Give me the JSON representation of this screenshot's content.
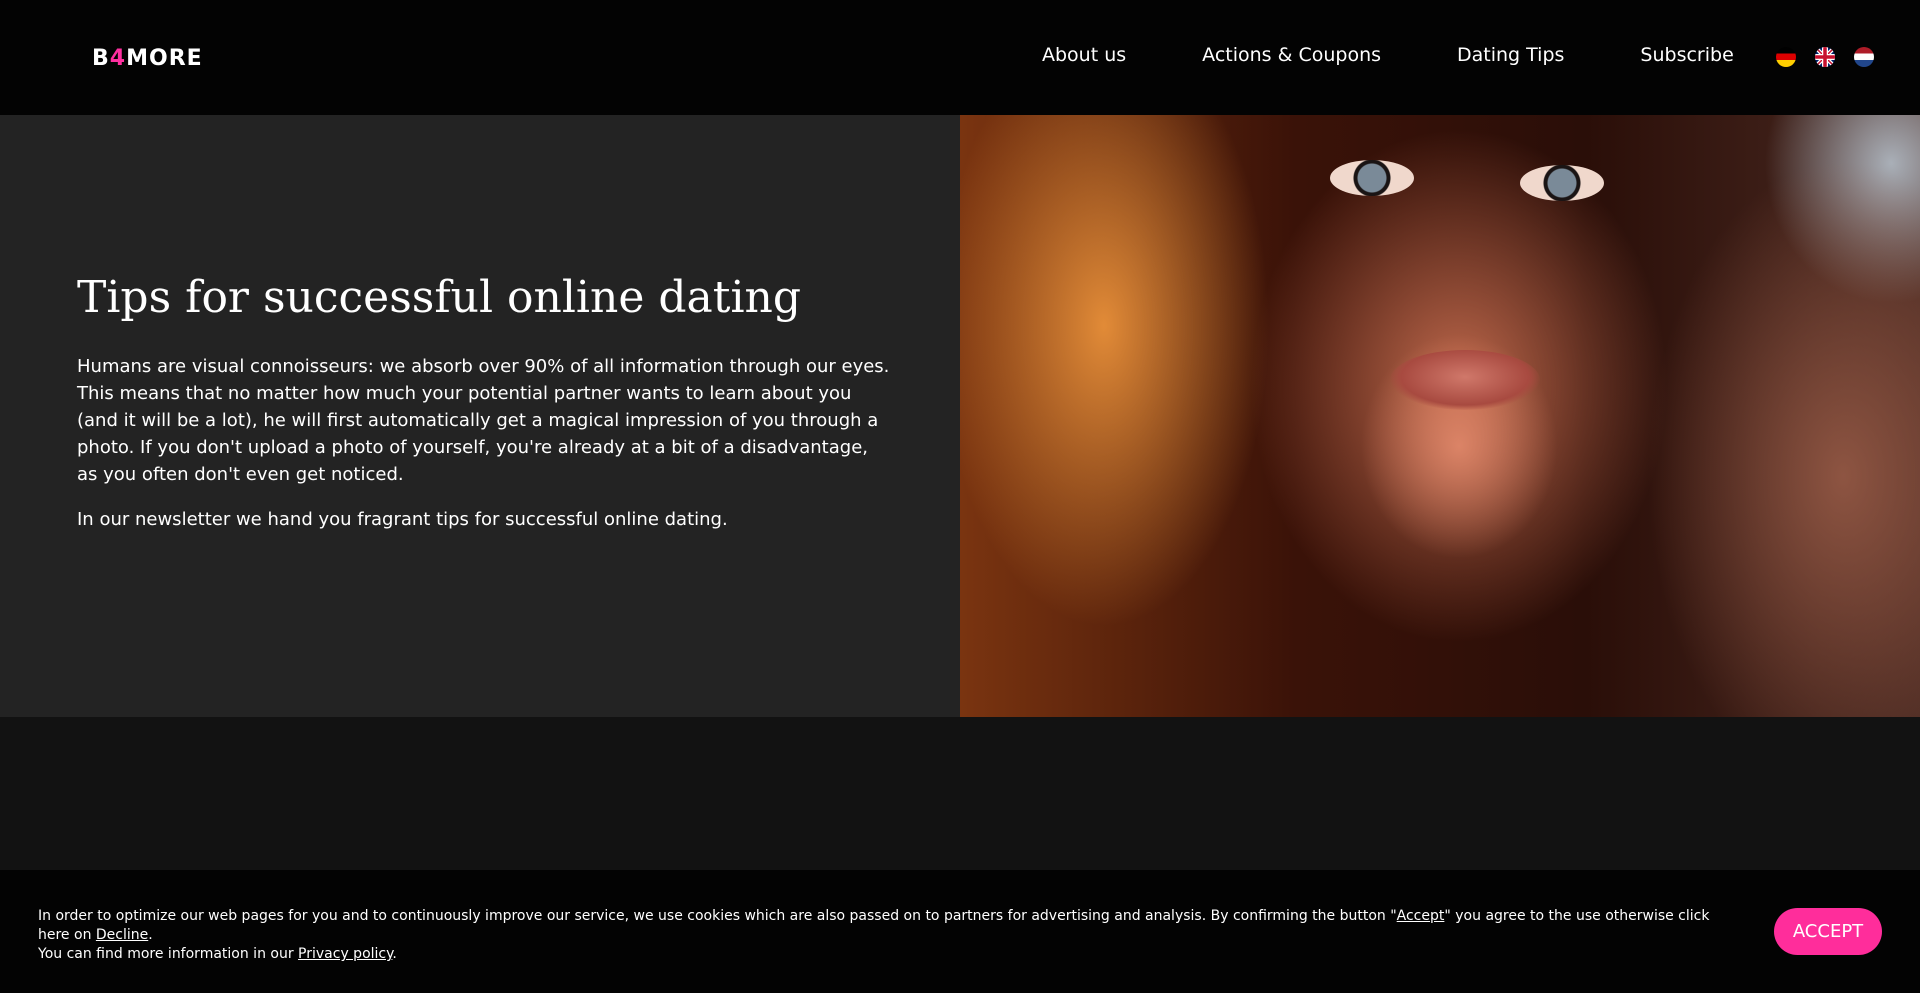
{
  "header": {
    "logo": {
      "prefix": "B",
      "accent": "4",
      "suffix": "MORE"
    },
    "nav": [
      {
        "label": "About us"
      },
      {
        "label": "Actions & Coupons"
      },
      {
        "label": "Dating Tips"
      },
      {
        "label": "Subscribe"
      }
    ],
    "languages": [
      "de-flag-icon",
      "uk-flag-icon",
      "nl-flag-icon"
    ]
  },
  "hero": {
    "title": "Tips for successful online dating",
    "paragraph1": "Humans are visual connoisseurs: we absorb over 90% of all information through our eyes. This means that no matter how much your potential partner wants to learn about you (and it will be a lot), he will first automatically get a magical impression of you through a photo. If you don't upload a photo of yourself, you're already at a bit of a disadvantage, as you often don't even get noticed.",
    "paragraph2": "In our newsletter we hand you fragrant tips for successful online dating.",
    "image": "woman-portrait-photo"
  },
  "cookie_banner": {
    "text_part1": "In order to optimize our web pages for you and to continuously improve our service, we use cookies which are also passed on to partners for advertising and analysis. By confirming the button \"",
    "accept_link": "Accept",
    "text_part2": "\" you agree to the use otherwise click here on ",
    "decline_link": "Decline",
    "text_part3": ".",
    "text_part4": "You can find more information in our ",
    "privacy_link": "Privacy policy",
    "text_part5": ".",
    "accept_button": "ACCEPT"
  },
  "colors": {
    "accent": "#ff2d9b",
    "header_bg": "#030303",
    "hero_bg": "#232323",
    "page_bg": "#121212"
  }
}
